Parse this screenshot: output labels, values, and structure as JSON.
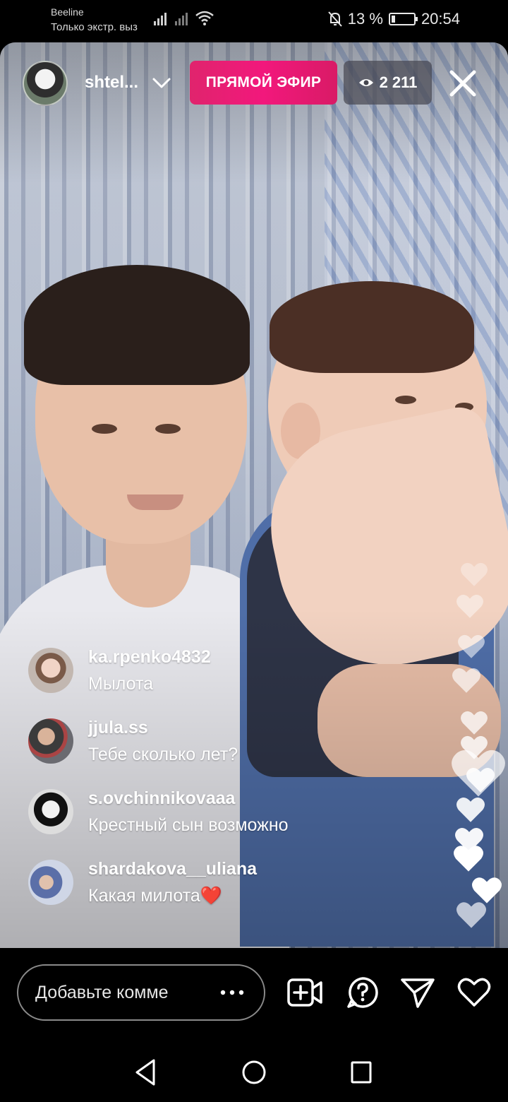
{
  "status_bar": {
    "carrier": "Beeline",
    "carrier_sub": "Только экстр. выз",
    "battery": "13 %",
    "time": "20:54"
  },
  "live": {
    "host_name": "shtel...",
    "live_label": "ПРЯМОЙ ЭФИР",
    "viewer_count": "2 211"
  },
  "comments": [
    {
      "username": "ka.rpenko4832",
      "text": "Мылота",
      "emoji": ""
    },
    {
      "username": "jjula.ss",
      "text": "Тебе сколько лет?",
      "emoji": ""
    },
    {
      "username": "s.ovchinnikovaaa",
      "text": "Крестный сын возможно",
      "emoji": ""
    },
    {
      "username": "shardakova__uliana",
      "text": "Какая милота",
      "emoji": "❤️"
    }
  ],
  "bottom_bar": {
    "comment_placeholder": "Добавьте комме",
    "icons": [
      "more-icon",
      "add-video-icon",
      "question-icon",
      "send-icon",
      "heart-icon"
    ]
  },
  "colors": {
    "live_badge": "#f2187c",
    "heart_emoji": "#f0543e"
  }
}
